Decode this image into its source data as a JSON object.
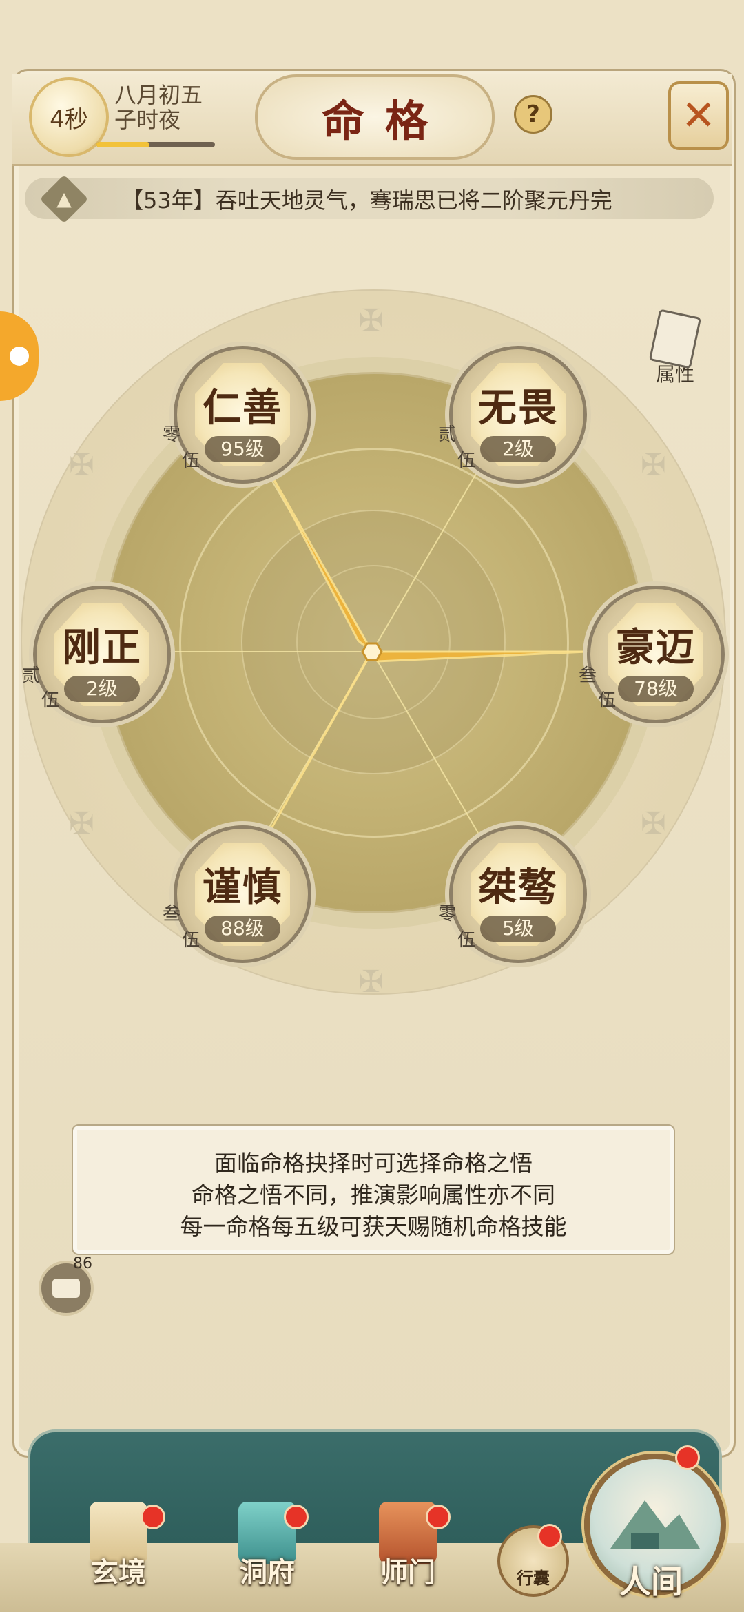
{
  "header": {
    "timer": "4秒",
    "date_line1": "八月初五",
    "date_line2": "子时夜",
    "progress_fraction": 0.45,
    "title": "命格",
    "help_label": "?",
    "close_icon": "close-icon"
  },
  "ticker": {
    "message": "【53年】吞吐天地灵气，骞瑞思已将二阶聚元丹完"
  },
  "side": {
    "attributes_label": "属性"
  },
  "nodes": [
    {
      "name": "仁善",
      "level": "95级",
      "tag1": "零",
      "tag2": "伍"
    },
    {
      "name": "无畏",
      "level": "2级",
      "tag1": "贰",
      "tag2": "伍"
    },
    {
      "name": "刚正",
      "level": "2级",
      "tag1": "贰",
      "tag2": "伍"
    },
    {
      "name": "豪迈",
      "level": "78级",
      "tag1": "叁",
      "tag2": "伍"
    },
    {
      "name": "谨慎",
      "level": "88级",
      "tag1": "叁",
      "tag2": "伍"
    },
    {
      "name": "桀骜",
      "level": "5级",
      "tag1": "零",
      "tag2": "伍"
    }
  ],
  "info": {
    "line1": "面临命格抉择时可选择命格之悟",
    "line2": "命格之悟不同，推演影响属性亦不同",
    "line3": "每一命格每五级可获天赐随机命格技能"
  },
  "chat": {
    "count": "86"
  },
  "nav": {
    "items": [
      {
        "label": "玄境"
      },
      {
        "label": "洞府"
      },
      {
        "label": "师门"
      }
    ],
    "bag_label": "行囊",
    "world_label": "人间"
  },
  "colors": {
    "accent_gold": "#f2c23a",
    "title_red": "#7a2514",
    "nav_teal": "#2e5e5b",
    "badge_red": "#e63327"
  }
}
